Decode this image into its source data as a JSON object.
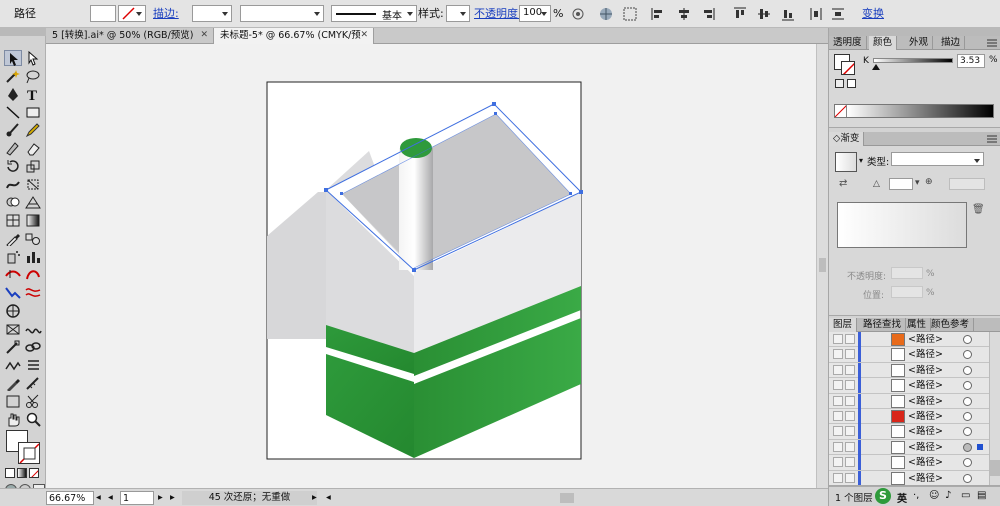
{
  "control_bar": {
    "object_label": "路径",
    "stroke_label": "描边:",
    "brush_label": "基本",
    "style_label": "样式:",
    "opacity_label": "不透明度:",
    "opacity_value": "100",
    "opacity_unit": "%",
    "transform_label": "变换"
  },
  "tabs": [
    {
      "label": "5 [转换].ai* @ 50% (RGB/预览)"
    },
    {
      "label": "未标题-5* @ 66.67% (CMYK/预览)"
    }
  ],
  "status": {
    "zoom": "66.67%",
    "page": "1",
    "history": "45 次还原；无重做"
  },
  "panels": {
    "top_tabs": [
      "透明度",
      "颜色",
      "外观",
      "描边"
    ],
    "color": {
      "channel": "K",
      "value": "3.53",
      "unit": "%",
      "level": 0.0353
    },
    "gradient": {
      "tab": "渐变",
      "type_label": "类型:",
      "opacity_label": "不透明度:",
      "opacity_unit": "%",
      "position_label": "位置:",
      "position_unit": "%"
    },
    "layers_tabs": [
      "图层",
      "路径查找",
      "属性",
      "颜色参考"
    ],
    "layers": [
      {
        "name": "<路径>",
        "swatch": "#e86a1a"
      },
      {
        "name": "<路径>",
        "swatch": "#ffffff"
      },
      {
        "name": "<路径>",
        "swatch": "#ffffff"
      },
      {
        "name": "<路径>",
        "swatch": "#ffffff"
      },
      {
        "name": "<路径>",
        "swatch": "#ffffff"
      },
      {
        "name": "<路径>",
        "swatch": "#d8261a"
      },
      {
        "name": "<路径>",
        "swatch": "#ffffff"
      },
      {
        "name": "<路径>",
        "swatch": "#ffffff"
      },
      {
        "name": "<路径>",
        "swatch": "#ffffff"
      },
      {
        "name": "<路径>",
        "swatch": "#ffffff"
      }
    ],
    "layer_count": "1 个图层",
    "ime": "英"
  },
  "colors": {
    "green": "#2f9a3c",
    "selection": "#3f6fe0",
    "roof_gray": "#c8c8ca",
    "wall_gray": "#e4e4e6"
  }
}
